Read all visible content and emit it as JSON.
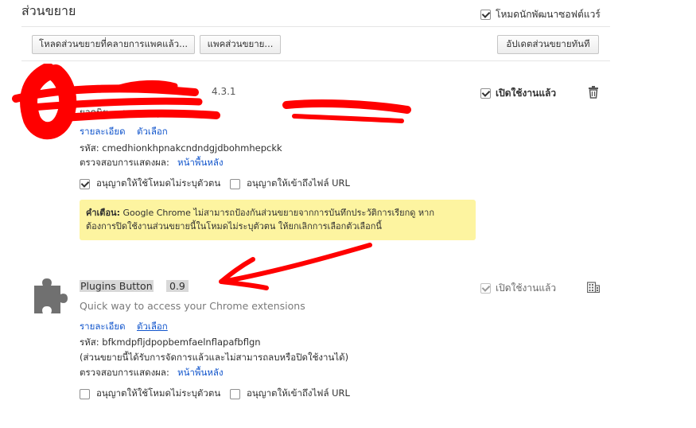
{
  "header": {
    "title": "ส่วนขยาย",
    "dev_mode_label": "โหมดนักพัฒนาซอฟต์แวร์",
    "dev_mode_checked": true
  },
  "toolbar": {
    "load_unpacked_label": "โหลดส่วนขยายที่คลายการแพคแล้ว...",
    "pack_label": "แพคส่วนขยาย...",
    "update_label": "อัปเดตส่วนขยายทันที"
  },
  "extensions": [
    {
      "version": "4.3.1",
      "enabled_label": "เปิดใช้งานแล้ว",
      "enabled": true,
      "description": "ยอดนิย ... ฯ นามสกุล: ลบ",
      "details_link": "รายละเอียด",
      "options_link": "ตัวเลือก",
      "id_label": "รหัส: cmedhionkhpnakcndndgjdbohmhepckk",
      "inspect_label": "ตรวจสอบการแสดงผล:",
      "inspect_link": "หน้าพื้นหลัง",
      "incognito_label": "อนุญาตให้ใช้โหมดไม่ระบุตัวตน",
      "incognito_checked": true,
      "file_url_label": "อนุญาตให้เข้าถึงไฟล์ URL",
      "file_url_checked": false,
      "warning_title": "คำเตือน:",
      "warning_text_1": " Google Chrome ไม่สามารถป้องกันส่วนขยายจากการบันทึกประวัติการเรียกดู หาก",
      "warning_text_2": "ต้องการปิดใช้งานส่วนขยายนี้ในโหมดไม่ระบุตัวตน ให้ยกเลิกการเลือกตัวเลือกนี้"
    },
    {
      "name": "Plugins Button",
      "version": "0.9",
      "description": "Quick way to access your Chrome extensions",
      "enabled_label": "เปิดใช้งานแล้ว",
      "enabled": true,
      "details_link": "รายละเอียด",
      "options_link": "ตัวเลือก",
      "id_label": "รหัส: bfkmdpfljdpopbemfaelnflapafbflgn",
      "managed_note": "(ส่วนขยายนี้ได้รับการจัดการแล้วและไม่สามารถลบหรือปิดใช้งานได้)",
      "inspect_label": "ตรวจสอบการแสดงผล:",
      "inspect_link": "หน้าพื้นหลัง",
      "incognito_label": "อนุญาตให้ใช้โหมดไม่ระบุตัวตน",
      "incognito_checked": false,
      "file_url_label": "อนุญาตให้เข้าถึงไฟล์ URL",
      "file_url_checked": false,
      "icon": "puzzle-piece-icon",
      "action_icon": "building-policy-icon"
    }
  ],
  "colors": {
    "link": "#1155cc",
    "warning_bg": "#fdf4a0",
    "annotation_red": "#ff0000"
  }
}
